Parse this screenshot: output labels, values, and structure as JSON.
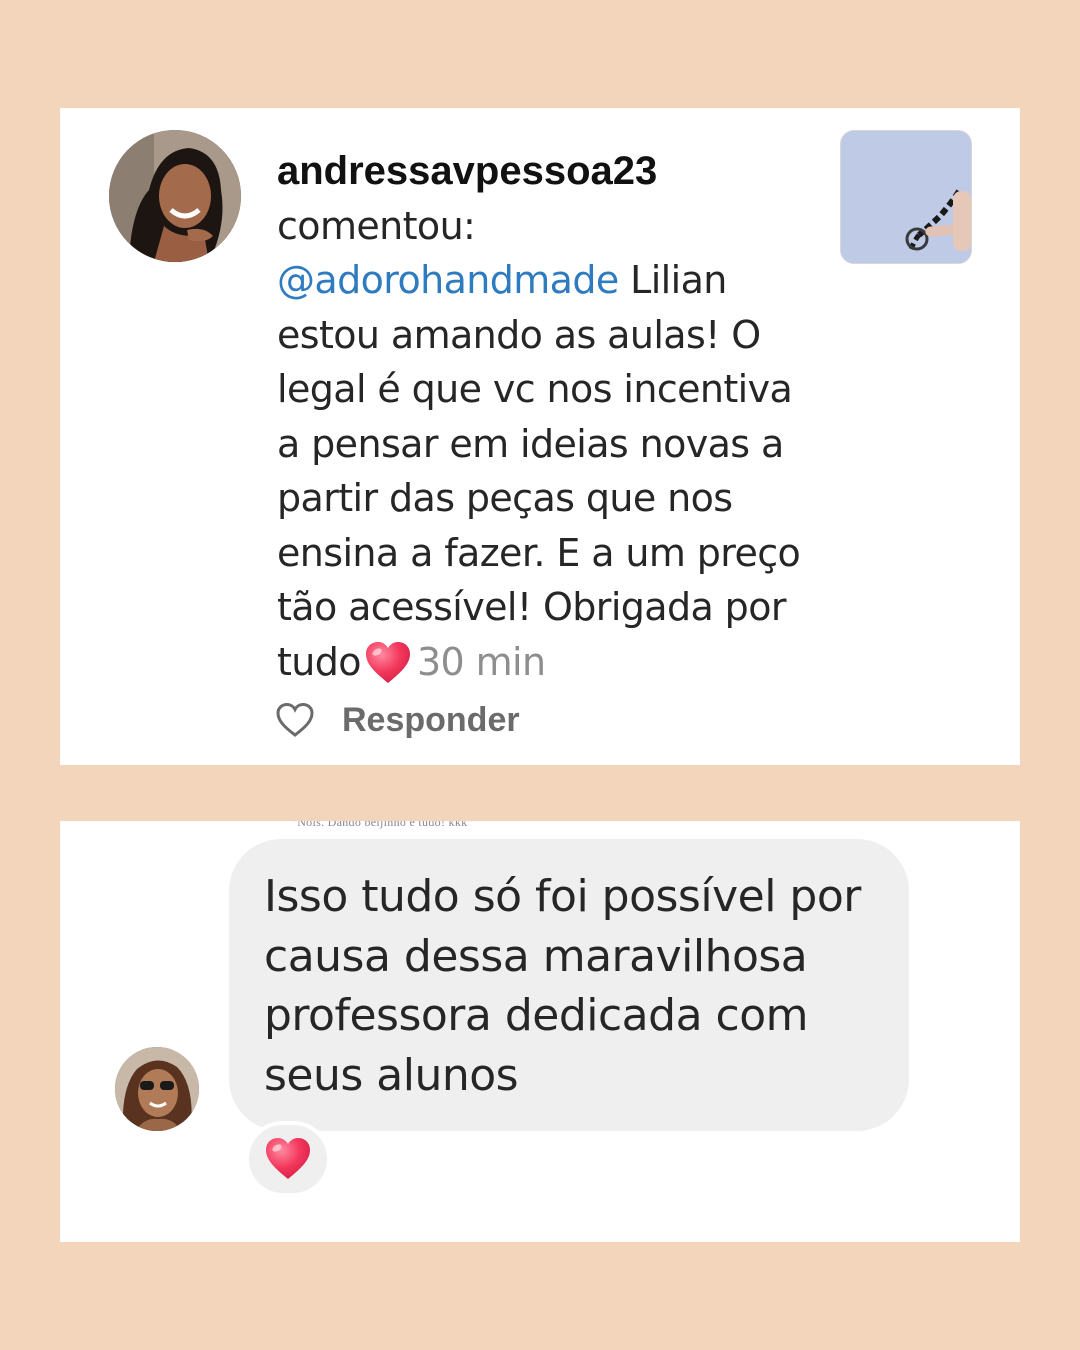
{
  "comment_card": {
    "username": "andressavpessoa23",
    "action": "comentou:",
    "mention": "@adorohandmade",
    "comment_text": "Lilian estou amando as aulas! O legal é que vc nos incentiva a pensar em ideias novas a partir das peças que nos ensina a fazer. E a um preço tão acessível! Obrigada por tudo",
    "timestamp": "30 min",
    "reply_label": "Responder",
    "icons": [
      "heart-emoji-icon",
      "like-heart-icon"
    ],
    "colors": {
      "mention": "#2f7bc0",
      "timestamp": "#8e8e8e",
      "heart": "#f03a5f"
    }
  },
  "message_card": {
    "cut_off_text": "\"Nois. Dando beijinho e tudo! kkk\"",
    "message": "Isso tudo só foi possível por causa dessa maravilhosa professora dedicada com seus alunos",
    "reaction_icon": "heart-reaction-icon",
    "colors": {
      "bubble": "#efefef"
    }
  },
  "colors": {
    "background": "#f2d5ba",
    "card": "#ffffff"
  }
}
